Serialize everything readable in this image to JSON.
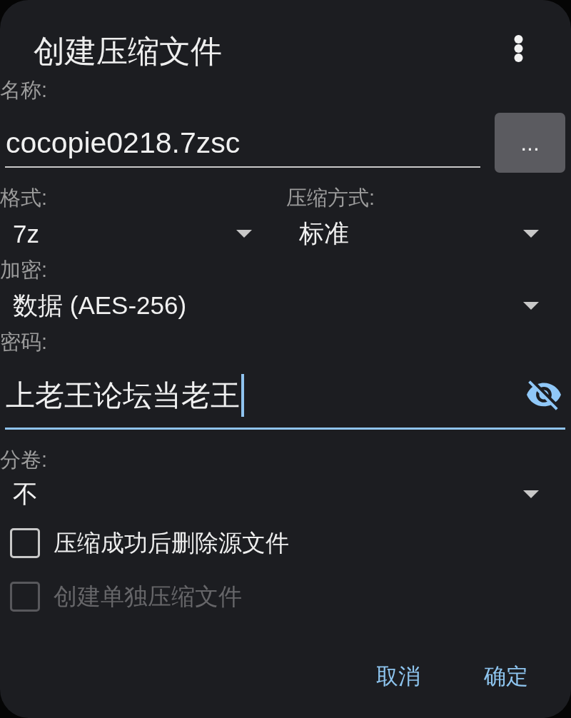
{
  "dialog": {
    "title": "创建压缩文件"
  },
  "name": {
    "label": "名称:",
    "value": "cocopie0218.7zsc",
    "browse_button": "..."
  },
  "format": {
    "label": "格式:",
    "value": "7z"
  },
  "method": {
    "label": "压缩方式:",
    "value": "标准"
  },
  "encryption": {
    "label": "加密:",
    "value": "数据 (AES-256)"
  },
  "password": {
    "label": "密码:",
    "value": "上老王论坛当老王",
    "focused": true
  },
  "split": {
    "label": "分卷:",
    "value": "不"
  },
  "options": [
    {
      "label": "压缩成功后删除源文件",
      "checked": false,
      "disabled": false
    },
    {
      "label": "创建单独压缩文件",
      "checked": false,
      "disabled": true
    }
  ],
  "buttons": [
    "取消",
    "确定"
  ]
}
